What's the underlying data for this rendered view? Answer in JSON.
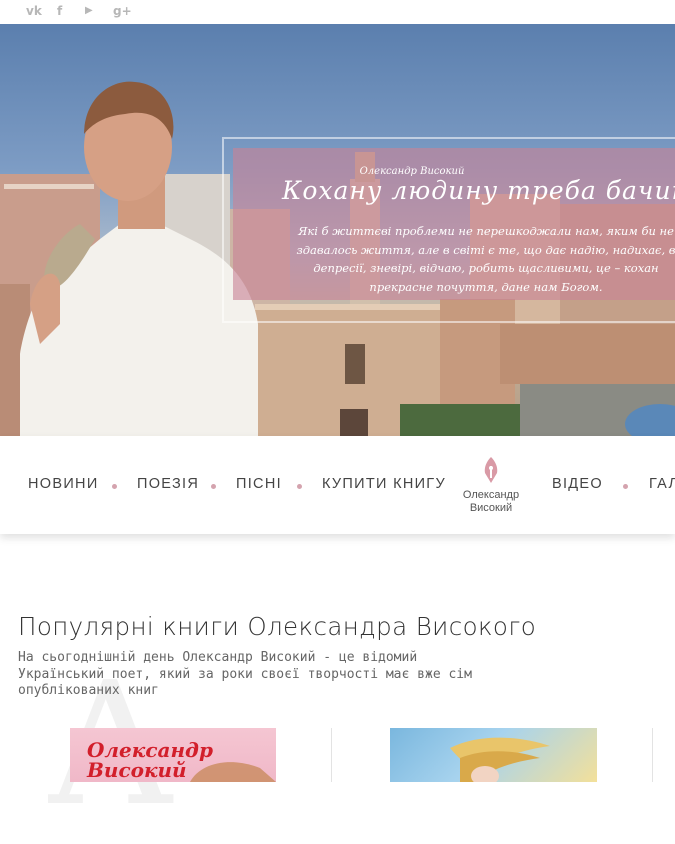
{
  "social": [
    {
      "icon": "vk-icon",
      "glyph": "vk"
    },
    {
      "icon": "facebook-icon",
      "glyph": "f"
    },
    {
      "icon": "youtube-icon",
      "glyph": "▶"
    },
    {
      "icon": "google-plus-icon",
      "glyph": "g+"
    }
  ],
  "hero": {
    "quote_author": "Олександр Високий",
    "quote_title": "Кохану людину треба бачити с",
    "quote_text": "Які б життєві проблеми не перешкоджали нам, яким би не\nздавалось життя, але в світі є те, що дає надію, надихає, в\nдепресії, зневірі, відчаю, робить щасливими, це – кохан\nпрекрасне почуття, дане нам Богом."
  },
  "nav": {
    "items": [
      "НОВИНИ",
      "ПОЕЗІЯ",
      "ПІСНІ",
      "КУПИТИ КНИГУ",
      "ВІДЕО",
      "ГАЛ"
    ],
    "logo_line1": "Олександр",
    "logo_line2": "Високий"
  },
  "main": {
    "title": "Популярні книги Олександра Високого",
    "description": "На сьогоднішній день Олександр Високий - це відомий Український поет, який за роки своєї творчості має вже сім опублікованих книг",
    "watermark": "А",
    "books": [
      {
        "cover_line1": "Олександр",
        "cover_line2": "Високий"
      },
      {}
    ]
  },
  "colors": {
    "accent": "#d4a3ae",
    "quote_overlay": "#c88296"
  }
}
